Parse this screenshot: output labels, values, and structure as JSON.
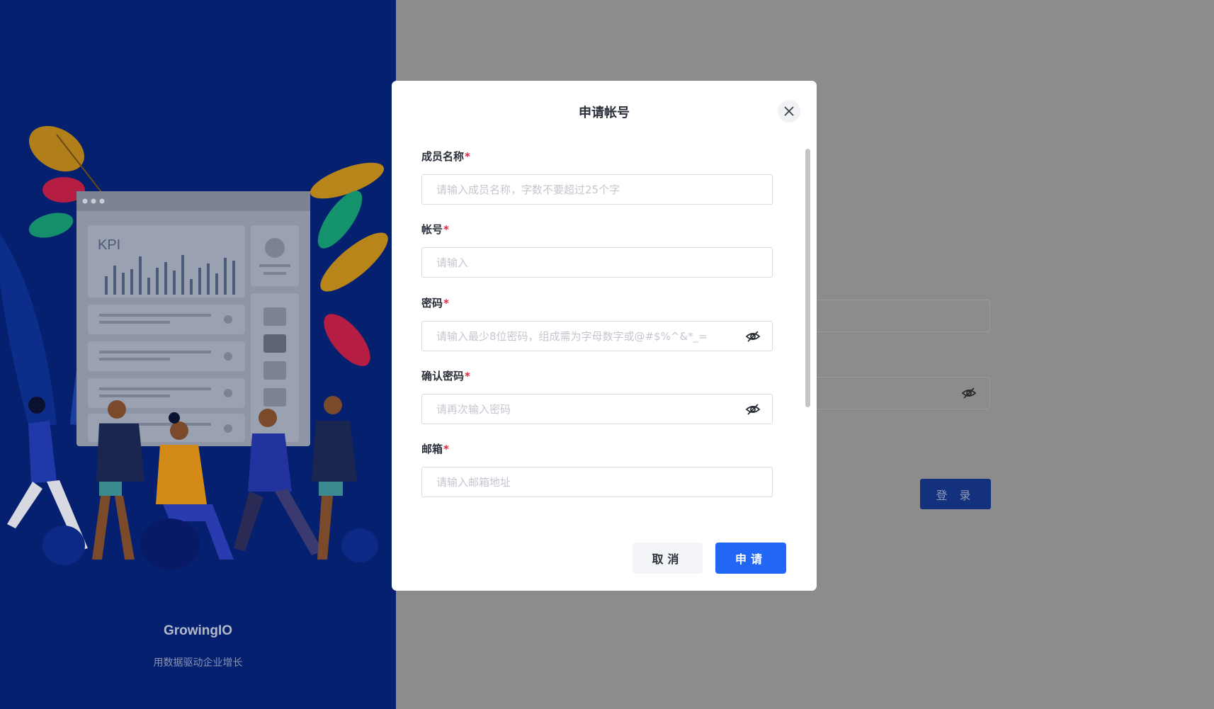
{
  "brand": {
    "name": "GrowingIO",
    "slogan": "用数据驱动企业增长",
    "illustration_text": "KPI"
  },
  "background_form": {
    "login_label": "登 录"
  },
  "modal": {
    "title": "申请帐号",
    "fields": [
      {
        "label": "成员名称",
        "required_mark": "*",
        "placeholder": "请输入成员名称，字数不要超过25个字",
        "value": ""
      },
      {
        "label": "帐号",
        "required_mark": "*",
        "placeholder": "请输入",
        "value": ""
      },
      {
        "label": "密码",
        "required_mark": "*",
        "placeholder": "请输入最少8位密码，组成需为字母数字或@#$%^&*_=",
        "value": "",
        "icon": "eye-hidden-icon"
      },
      {
        "label": "确认密码",
        "required_mark": "*",
        "placeholder": "请再次输入密码",
        "value": "",
        "icon": "eye-hidden-icon"
      },
      {
        "label": "邮箱",
        "required_mark": "*",
        "placeholder": "请输入邮箱地址",
        "value": ""
      }
    ],
    "cancel_label": "取消",
    "submit_label": "申请"
  },
  "colors": {
    "brand_panel": "#04206f",
    "overlay": "#8c8c8c",
    "primary": "#2266f5",
    "required": "#e8223e"
  }
}
